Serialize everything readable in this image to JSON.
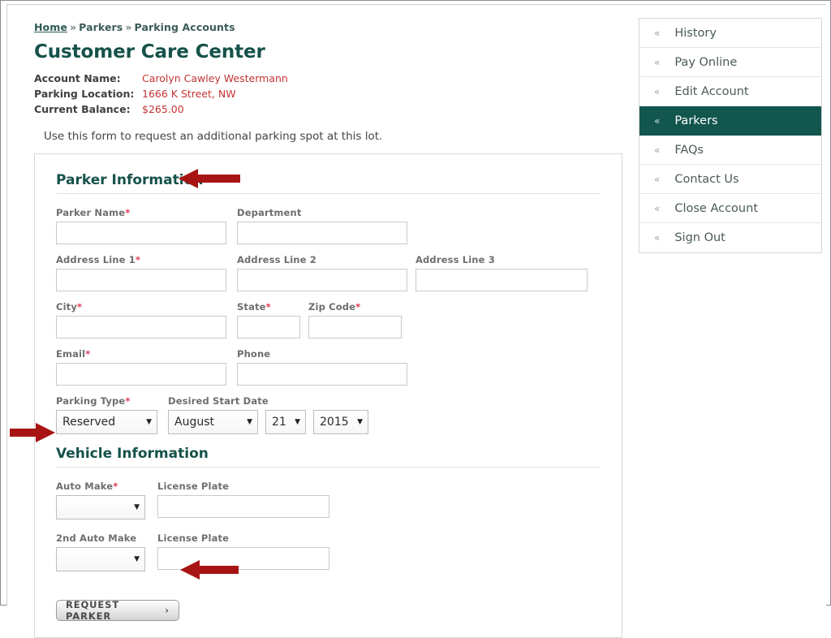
{
  "breadcrumb": {
    "home": "Home",
    "sep": "»",
    "level2": "Parkers",
    "level3": "Parking Accounts"
  },
  "page_title": "Customer Care Center",
  "account": {
    "rows": [
      {
        "label": "Account Name:",
        "value": "Carolyn Cawley Westermann"
      },
      {
        "label": "Parking Location:",
        "value": "1666 K Street, NW"
      },
      {
        "label": "Current Balance:",
        "value": "$265.00"
      }
    ]
  },
  "intro_text": "Use this form to request an additional parking spot at this lot.",
  "form": {
    "parker_section_title": "Parker Information",
    "vehicle_section_title": "Vehicle Information",
    "required_marker": "*",
    "fields": {
      "parker_name": {
        "label": "Parker Name",
        "value": "",
        "required": true
      },
      "department": {
        "label": "Department",
        "value": "",
        "required": false
      },
      "address1": {
        "label": "Address Line 1",
        "value": "",
        "required": true
      },
      "address2": {
        "label": "Address Line 2",
        "value": "",
        "required": false
      },
      "address3": {
        "label": "Address Line 3",
        "value": "",
        "required": false
      },
      "city": {
        "label": "City",
        "value": "",
        "required": true
      },
      "state": {
        "label": "State",
        "value": "",
        "required": true
      },
      "zip": {
        "label": "Zip Code",
        "value": "",
        "required": true
      },
      "email": {
        "label": "Email",
        "value": "",
        "required": true
      },
      "phone": {
        "label": "Phone",
        "value": "",
        "required": false
      },
      "parking_type": {
        "label": "Parking Type",
        "value": "Reserved",
        "required": true
      },
      "desired_start_date": {
        "label": "Desired Start Date",
        "required": false
      },
      "start_month": {
        "value": "August"
      },
      "start_day": {
        "value": "21"
      },
      "start_year": {
        "value": "2015"
      },
      "auto_make": {
        "label": "Auto Make",
        "value": "",
        "required": true
      },
      "license_plate_1": {
        "label": "License Plate",
        "value": "",
        "required": false
      },
      "auto_make_2": {
        "label": "2nd Auto Make",
        "value": "",
        "required": false
      },
      "license_plate_2": {
        "label": "License Plate",
        "value": "",
        "required": false
      }
    },
    "submit_label": "REQUEST PARKER",
    "submit_chevron": "›"
  },
  "sidebar": {
    "chevron": "«",
    "items": [
      {
        "label": "History",
        "active": false
      },
      {
        "label": "Pay Online",
        "active": false
      },
      {
        "label": "Edit Account",
        "active": false
      },
      {
        "label": "Parkers",
        "active": true
      },
      {
        "label": "FAQs",
        "active": false
      },
      {
        "label": "Contact Us",
        "active": false
      },
      {
        "label": "Close Account",
        "active": false
      },
      {
        "label": "Sign Out",
        "active": false
      }
    ]
  },
  "annotations": {
    "color": "#A81414",
    "arrows": [
      {
        "name": "arrow-parker-information",
        "direction": "left"
      },
      {
        "name": "arrow-vehicle-information",
        "direction": "right"
      },
      {
        "name": "arrow-request-parker",
        "direction": "left"
      }
    ]
  },
  "colors": {
    "brand_green": "#15524a",
    "accent_red": "#c33434",
    "required_red": "#e03a54",
    "annotation_red": "#A81414"
  }
}
